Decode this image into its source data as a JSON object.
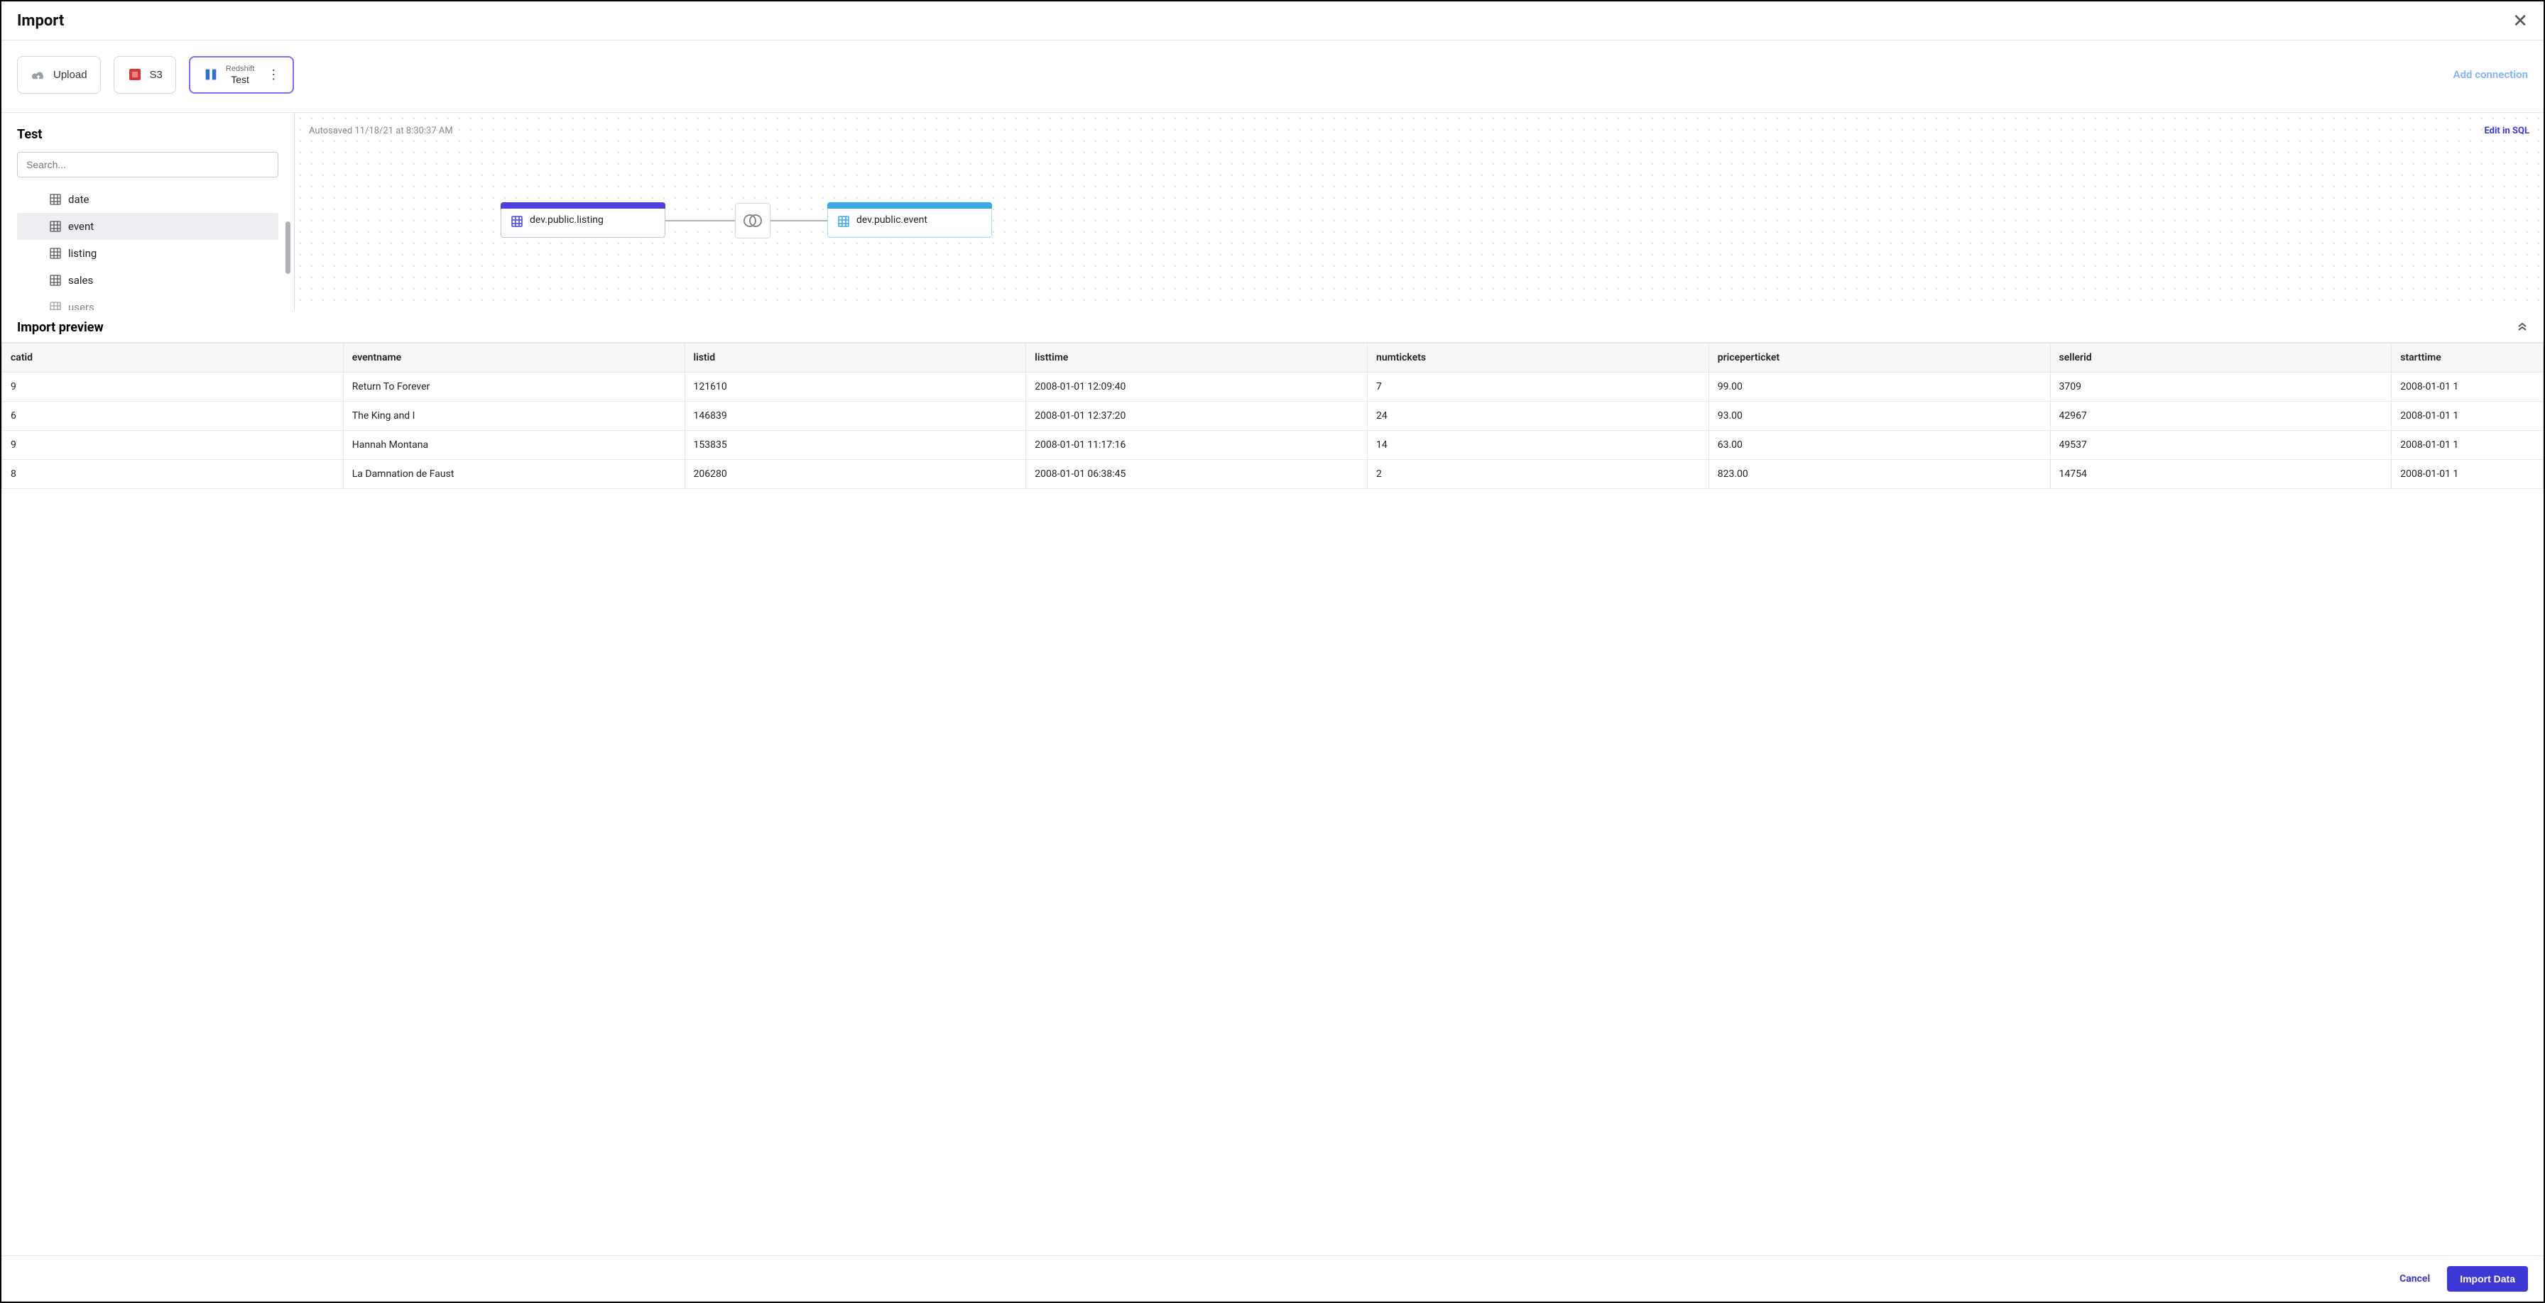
{
  "header": {
    "title": "Import"
  },
  "sources": {
    "upload_label": "Upload",
    "s3_label": "S3",
    "redshift_top": "Redshift",
    "redshift_name": "Test",
    "add_connection": "Add connection"
  },
  "sidebar": {
    "title": "Test",
    "search_placeholder": "Search...",
    "tables": [
      "date",
      "event",
      "listing",
      "sales",
      "users"
    ],
    "selected_index": 1
  },
  "canvas": {
    "autosave": "Autosaved 11/18/21 at 8:30:37 AM",
    "edit_sql": "Edit in SQL",
    "node_a": "dev.public.listing",
    "node_b": "dev.public.event"
  },
  "preview": {
    "heading": "Import preview",
    "columns": [
      "catid",
      "eventname",
      "listid",
      "listtime",
      "numtickets",
      "priceperticket",
      "sellerid",
      "starttime"
    ],
    "rows": [
      [
        "9",
        "Return To Forever",
        "121610",
        "2008-01-01 12:09:40",
        "7",
        "99.00",
        "3709",
        "2008-01-01 1"
      ],
      [
        "6",
        "The King and I",
        "146839",
        "2008-01-01 12:37:20",
        "24",
        "93.00",
        "42967",
        "2008-01-01 1"
      ],
      [
        "9",
        "Hannah Montana",
        "153835",
        "2008-01-01 11:17:16",
        "14",
        "63.00",
        "49537",
        "2008-01-01 1"
      ],
      [
        "8",
        "La Damnation de Faust",
        "206280",
        "2008-01-01 06:38:45",
        "2",
        "823.00",
        "14754",
        "2008-01-01 1"
      ]
    ]
  },
  "footer": {
    "cancel": "Cancel",
    "import": "Import Data"
  }
}
